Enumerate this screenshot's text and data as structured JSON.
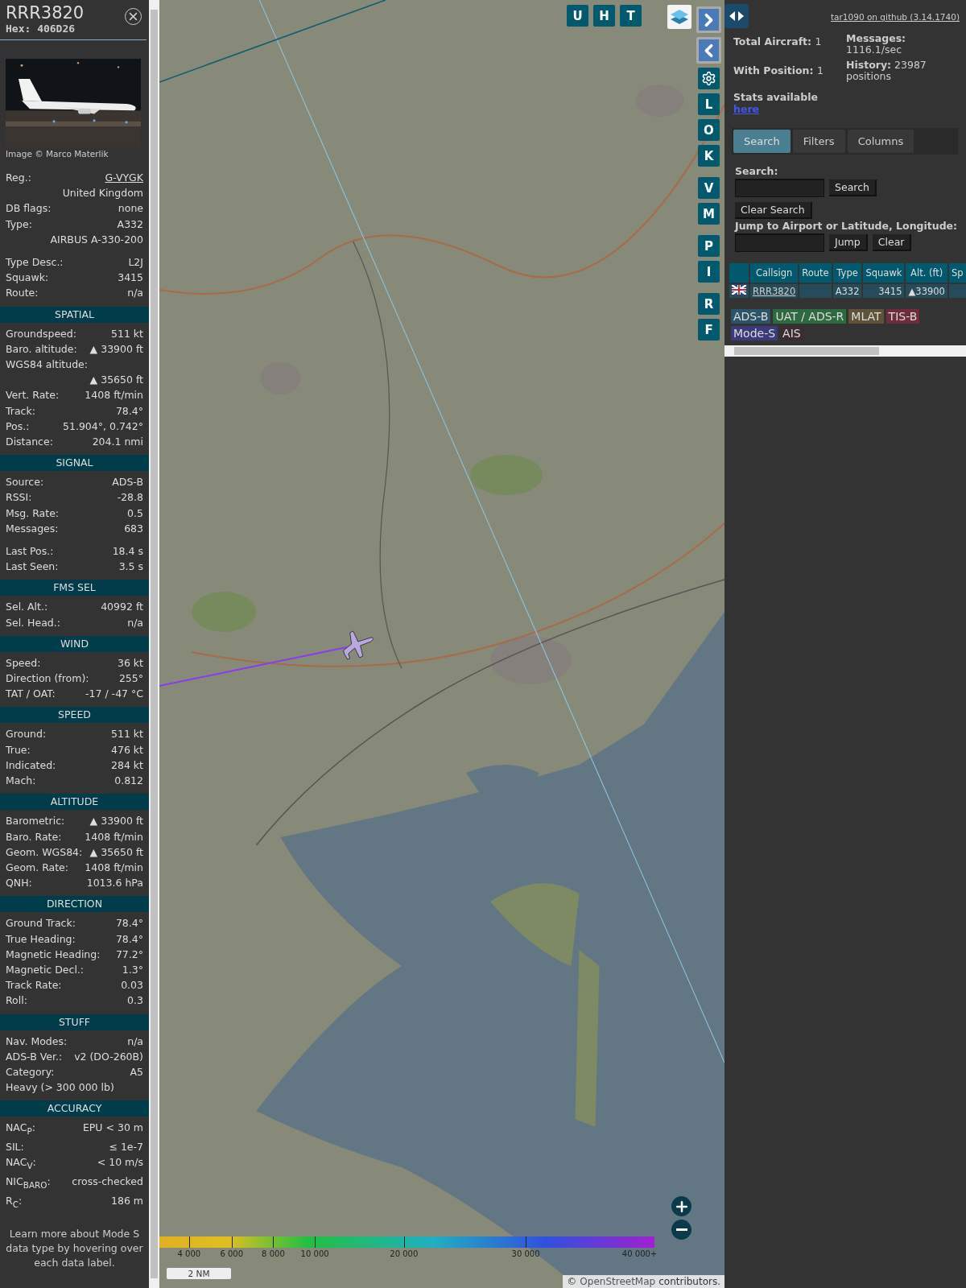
{
  "detail": {
    "callsign": "RRR3820",
    "hex": "Hex: 406D26",
    "photo": {
      "kind": "picture",
      "credit": "Image © Marco Materlik"
    },
    "groups": [
      [
        {
          "label": "Reg.:",
          "link": "G-VYGK"
        },
        {
          "value": "United Kingdom"
        },
        {
          "label": "DB flags:",
          "value": "none"
        },
        {
          "label": "Type:",
          "value": "A332"
        },
        {
          "value": "AIRBUS A-330-200"
        }
      ],
      [
        {
          "label": "Type Desc.:",
          "value": "L2J"
        },
        {
          "label": "Squawk:",
          "value": "3415"
        },
        {
          "label": "Route:",
          "value": "n/a"
        }
      ]
    ],
    "sections": [
      {
        "title": "SPATIAL",
        "groups": [
          [
            {
              "label": "Groundspeed:",
              "value": "511 kt"
            },
            {
              "label": "Baro. altitude:",
              "value": "▲ 33900 ft"
            },
            {
              "label": "WGS84 altitude:"
            },
            {
              "value": "▲ 35650 ft"
            },
            {
              "label": "Vert. Rate:",
              "value": "1408 ft/min"
            },
            {
              "label": "Track:",
              "value": "78.4°"
            },
            {
              "label": "Pos.:",
              "value": "51.904°, 0.742°"
            },
            {
              "label": "Distance:",
              "value": "204.1 nmi"
            }
          ]
        ]
      },
      {
        "title": "SIGNAL",
        "groups": [
          [
            {
              "label": "Source:",
              "value": "ADS-B"
            },
            {
              "label": "RSSI:",
              "value": "-28.8"
            },
            {
              "label": "Msg. Rate:",
              "value": "0.5"
            },
            {
              "label": "Messages:",
              "value": "683"
            }
          ],
          [
            {
              "label": "Last Pos.:",
              "value": "18.4 s"
            },
            {
              "label": "Last Seen:",
              "value": "3.5 s"
            }
          ]
        ]
      },
      {
        "title": "FMS SEL",
        "groups": [
          [
            {
              "label": "Sel. Alt.:",
              "value": "40992 ft"
            },
            {
              "label": "Sel. Head.:",
              "value": "n/a"
            }
          ]
        ]
      },
      {
        "title": "WIND",
        "groups": [
          [
            {
              "label": "Speed:",
              "value": "36 kt"
            },
            {
              "label": "Direction (from):",
              "value": "255°"
            },
            {
              "label": "TAT / OAT:",
              "value": "-17 / -47 °C"
            }
          ]
        ]
      },
      {
        "title": "SPEED",
        "groups": [
          [
            {
              "label": "Ground:",
              "value": "511 kt"
            },
            {
              "label": "True:",
              "value": "476 kt"
            },
            {
              "label": "Indicated:",
              "value": "284 kt"
            },
            {
              "label": "Mach:",
              "value": "0.812"
            }
          ]
        ]
      },
      {
        "title": "ALTITUDE",
        "groups": [
          [
            {
              "label": "Barometric:",
              "value": "▲ 33900 ft"
            },
            {
              "label": "Baro. Rate:",
              "value": "1408 ft/min"
            },
            {
              "label": "Geom. WGS84:",
              "value": "▲ 35650 ft"
            },
            {
              "label": "Geom. Rate:",
              "value": "1408 ft/min"
            },
            {
              "label": "QNH:",
              "value": "1013.6 hPa"
            }
          ]
        ]
      },
      {
        "title": "DIRECTION",
        "groups": [
          [
            {
              "label": "Ground Track:",
              "value": "78.4°"
            },
            {
              "label": "True Heading:",
              "value": "78.4°"
            },
            {
              "label": "Magnetic Heading:",
              "value": "77.2°"
            },
            {
              "label": "Magnetic Decl.:",
              "value": "1.3°"
            },
            {
              "label": "Track Rate:",
              "value": "0.03"
            },
            {
              "label": "Roll:",
              "value": "0.3"
            }
          ]
        ]
      },
      {
        "title": "STUFF",
        "groups": [
          [
            {
              "label": "Nav. Modes:",
              "value": "n/a"
            },
            {
              "label": "ADS-B Ver.:",
              "value": "v2 (DO-260B)"
            },
            {
              "label": "Category:",
              "value": "A5"
            },
            {
              "label": "Heavy (> 300 000 lb)"
            }
          ]
        ]
      },
      {
        "title": "ACCURACY",
        "groups": [
          [
            {
              "label": "NAC$_{P}$:",
              "value": "EPU < 30 m"
            },
            {
              "label": "SIL:",
              "value": "≤ 1e-7"
            },
            {
              "label": "NAC$_{V}$:",
              "value": "< 10 m/s"
            },
            {
              "label": "NIC$_{BARO}$:",
              "value": "cross-checked"
            },
            {
              "label": "R$_{C}$:",
              "value": "186 m"
            }
          ]
        ]
      }
    ],
    "footnote": "Learn more about Mode S data type by hovering over each data label."
  },
  "map": {
    "picture": {
      "kind": "picture"
    },
    "top_buttons": [
      "U",
      "H",
      "T"
    ],
    "side_buttons": [
      [
        "L",
        "O",
        "K"
      ],
      [
        "V",
        "M"
      ],
      [
        "P",
        "I"
      ],
      [
        "R",
        "F"
      ]
    ],
    "legend": [
      "4 000",
      "6 000",
      "8 000",
      "10 000",
      "20 000",
      "30 000",
      "40 000+"
    ],
    "scale": "2 NM",
    "attribution_prefix": "©",
    "attribution_link": "OpenStreetMap",
    "attribution_suffix": "contributors."
  },
  "panel": {
    "version_link": "tar1090 on github (3.14.1740)",
    "stats": [
      {
        "label": "Total Aircraft:",
        "value": "1"
      },
      {
        "label": "With Position:",
        "value": "1"
      }
    ],
    "stats_note": "Stats available",
    "stats_link": "here",
    "stats_right": [
      {
        "label": "Messages:",
        "value": "1116.1/sec"
      },
      {
        "label": "History:",
        "value": "23987 positions"
      }
    ],
    "tabs": [
      {
        "label": "Search",
        "selected": true
      },
      {
        "label": "Filters",
        "selected": false
      },
      {
        "label": "Columns",
        "selected": false
      }
    ],
    "search_label": "Search:",
    "search_button": "Search",
    "clear_search_button": "Clear Search",
    "jump_label": "Jump to Airport or Latitude, Longitude:",
    "jump_button": "Jump",
    "clear_button": "Clear",
    "table": {
      "columns": [
        "Callsign",
        "Route",
        "Type",
        "Squawk",
        "Alt. (ft)",
        "Sp"
      ],
      "rows": [
        {
          "callsign": "RRR3820",
          "type": "A332",
          "squawk": "3415",
          "altitude": "▲33900"
        }
      ]
    },
    "sources": [
      {
        "label": "ADS-B",
        "color": "#2c5468"
      },
      {
        "label": "UAT / ADS-R",
        "color": "#2c6b3e"
      },
      {
        "label": "MLAT",
        "color": "#5e5338"
      },
      {
        "label": "TIS-B",
        "color": "#6e2c3c"
      },
      {
        "label": "Mode-S",
        "color": "#3b3a7a"
      },
      {
        "label": "AIS",
        "color": "#3b2c30"
      }
    ]
  }
}
